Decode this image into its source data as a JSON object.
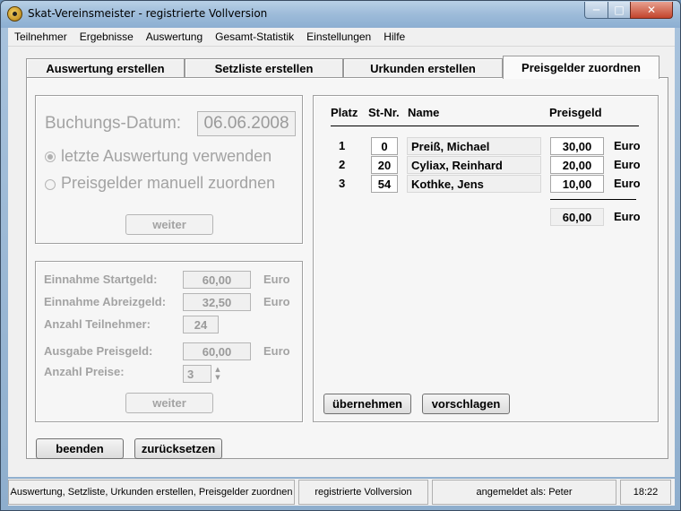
{
  "window": {
    "title": "Skat-Vereinsmeister - registrierte Vollversion",
    "min": "─",
    "max": "□",
    "close": "✕"
  },
  "menu": [
    "Teilnehmer",
    "Ergebnisse",
    "Auswertung",
    "Gesamt-Statistik",
    "Einstellungen",
    "Hilfe"
  ],
  "tabs": [
    "Auswertung erstellen",
    "Setzliste erstellen",
    "Urkunden erstellen",
    "Preisgelder zuordnen"
  ],
  "left_top": {
    "buchung_label": "Buchungs-Datum:",
    "buchung_value": "06.06.2008",
    "radio1": "letzte Auswertung verwenden",
    "radio2": "Preisgelder manuell zuordnen",
    "weiter": "weiter"
  },
  "left_bottom": {
    "startgeld_label": "Einnahme Startgeld:",
    "startgeld_value": "60,00",
    "abreiz_label": "Einnahme Abreizgeld:",
    "abreiz_value": "32,50",
    "teilnehmer_label": "Anzahl Teilnehmer:",
    "teilnehmer_value": "24",
    "preisgeld_label": "Ausgabe Preisgeld:",
    "preisgeld_value": "60,00",
    "preise_label": "Anzahl Preise:",
    "preise_value": "3",
    "euro": "Euro",
    "weiter": "weiter"
  },
  "right": {
    "headers": {
      "platz": "Platz",
      "stnr": "St-Nr.",
      "name": "Name",
      "preisgeld": "Preisgeld"
    },
    "rows": [
      {
        "platz": "1",
        "stnr": "0",
        "name": "Preiß, Michael",
        "preis": "30,00"
      },
      {
        "platz": "2",
        "stnr": "20",
        "name": "Cyliax, Reinhard",
        "preis": "20,00"
      },
      {
        "platz": "3",
        "stnr": "54",
        "name": "Kothke, Jens",
        "preis": "10,00"
      }
    ],
    "total": "60,00",
    "euro": "Euro",
    "uebernehmen": "übernehmen",
    "vorschlagen": "vorschlagen"
  },
  "footer": {
    "beenden": "beenden",
    "zuruecksetzen": "zurücksetzen"
  },
  "status": {
    "s1": "Auswertung, Setzliste, Urkunden erstellen, Preisgelder zuordnen",
    "s2": "registrierte Vollversion",
    "s3": "angemeldet als: Peter",
    "s4": "18:22"
  }
}
